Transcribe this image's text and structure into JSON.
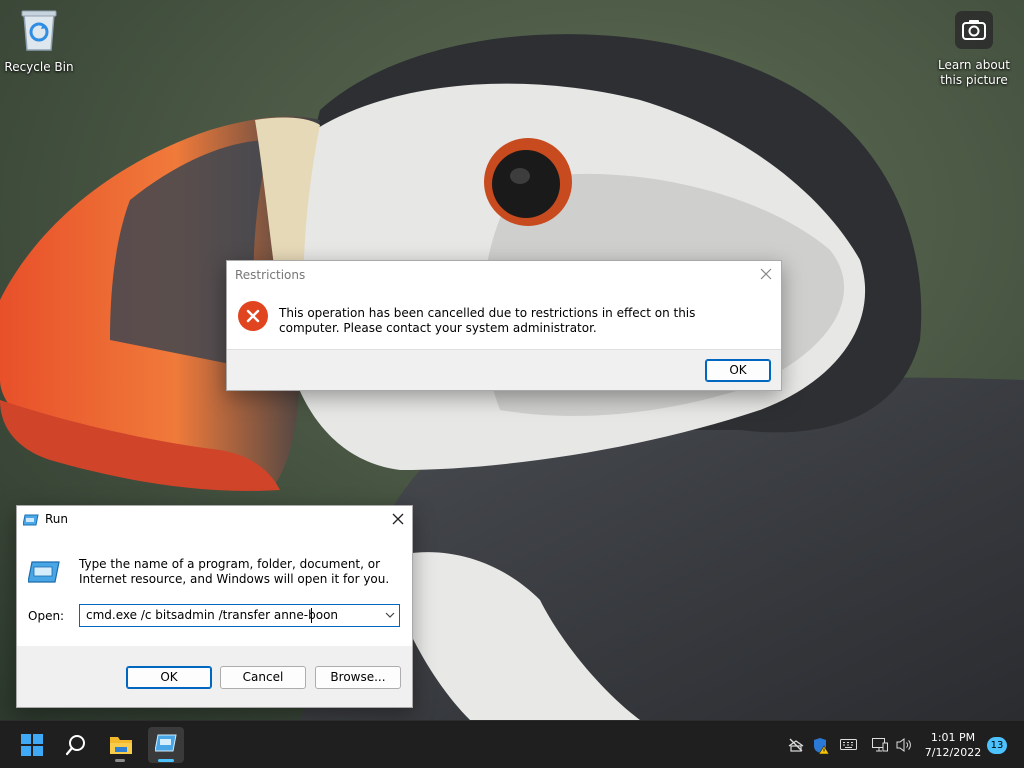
{
  "desktop": {
    "icons": [
      {
        "label": "Recycle Bin",
        "icon": "recycle-bin-icon"
      },
      {
        "label": "Learn about this picture",
        "icon": "camera-icon"
      }
    ]
  },
  "restrictions_dialog": {
    "title": "Restrictions",
    "message": "This operation has been cancelled due to restrictions in effect on this computer. Please contact your system administrator.",
    "ok_label": "OK",
    "icon": "error-icon"
  },
  "run_dialog": {
    "title": "Run",
    "description": "Type the name of a program, folder, document, or Internet resource, and Windows will open it for you.",
    "open_label": "Open:",
    "command_value": "cmd.exe /c bitsadmin /transfer anne-boon",
    "ok_label": "OK",
    "cancel_label": "Cancel",
    "browse_label": "Browse..."
  },
  "taskbar": {
    "items": [
      "start-icon",
      "search-icon",
      "file-explorer-icon",
      "run-app-icon"
    ],
    "tray": [
      "network-disconnected-icon",
      "security-warning-icon",
      "keyboard-icon",
      "display-icon",
      "speaker-icon"
    ],
    "time": "1:01 PM",
    "date": "7/12/2022",
    "notification_count": "13"
  },
  "colors": {
    "accent": "#0067c0",
    "error_red": "#e0451f",
    "taskbar_bg": "#1f1f1f",
    "notification_badge": "#4cc2ff"
  }
}
